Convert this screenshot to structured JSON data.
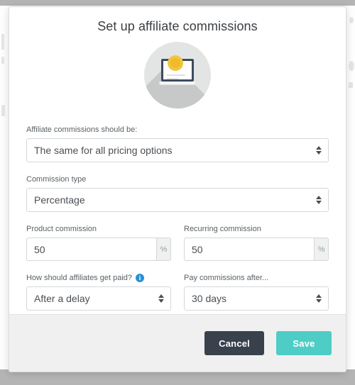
{
  "modal": {
    "title": "Set up affiliate commissions",
    "illustration": {
      "name": "laptop-with-badge-illustration"
    },
    "fields": {
      "commission_scope": {
        "label": "Affiliate commissions should be:",
        "value": "The same for all pricing options"
      },
      "commission_type": {
        "label": "Commission type",
        "value": "Percentage"
      },
      "product_commission": {
        "label": "Product commission",
        "value": "50",
        "addon": "%"
      },
      "recurring_commission": {
        "label": "Recurring commission",
        "value": "50",
        "addon": "%"
      },
      "payout_method": {
        "label": "How should affiliates get paid?",
        "info": "i",
        "value": "After a delay"
      },
      "payout_delay": {
        "label": "Pay commissions after...",
        "value": "30 days"
      }
    },
    "footer": {
      "cancel_label": "Cancel",
      "save_label": "Save"
    }
  },
  "colors": {
    "accent_teal": "#4ecdc6",
    "cancel_dark": "#39414d",
    "info_blue": "#2a8fd4",
    "badge_yellow": "#f3c53f",
    "footer_bg": "#f0f0f0",
    "backdrop": "#b4b4b4"
  }
}
